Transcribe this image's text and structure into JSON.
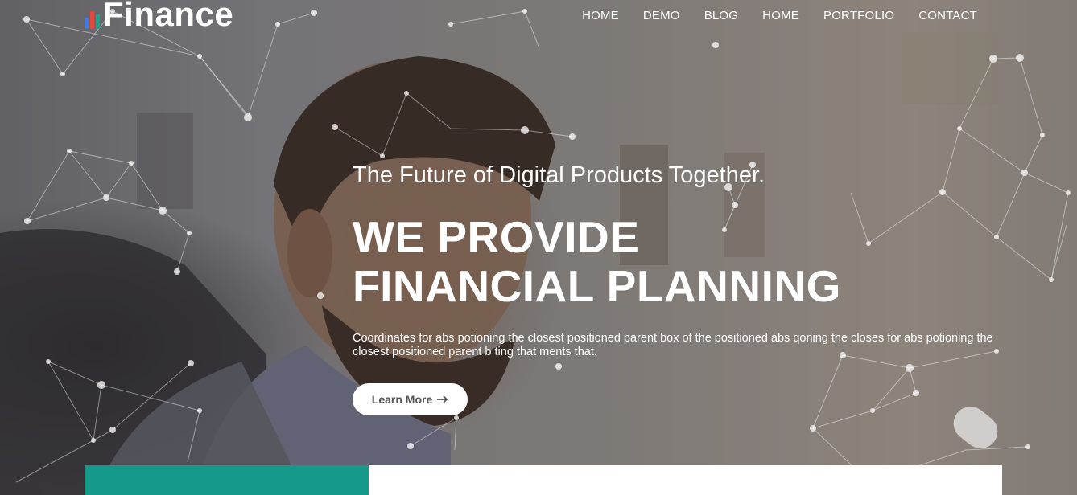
{
  "brand": {
    "name": "Finance",
    "bar_colors": [
      "#3e7be6",
      "#e4473d",
      "#18a58c"
    ]
  },
  "nav": {
    "items": [
      "HOME",
      "DEMO",
      "BLOG",
      "HOME",
      "PORTFOLIO",
      "CONTACT"
    ]
  },
  "hero": {
    "subtitle": "The Future of Digital Products Together.",
    "headline_line1": "WE PROVIDE",
    "headline_line2": "FINANCIAL PLANNING",
    "description": "Coordinates for abs potioning the closest positioned parent box of the positioned abs qoning the closes for abs potioning the closest positioned parent b ting that ments that.",
    "button_label": "Learn More",
    "button_icon": "arrow-right-icon"
  },
  "colors": {
    "teal_panel": "#14998a",
    "white_panel": "#ffffff"
  }
}
